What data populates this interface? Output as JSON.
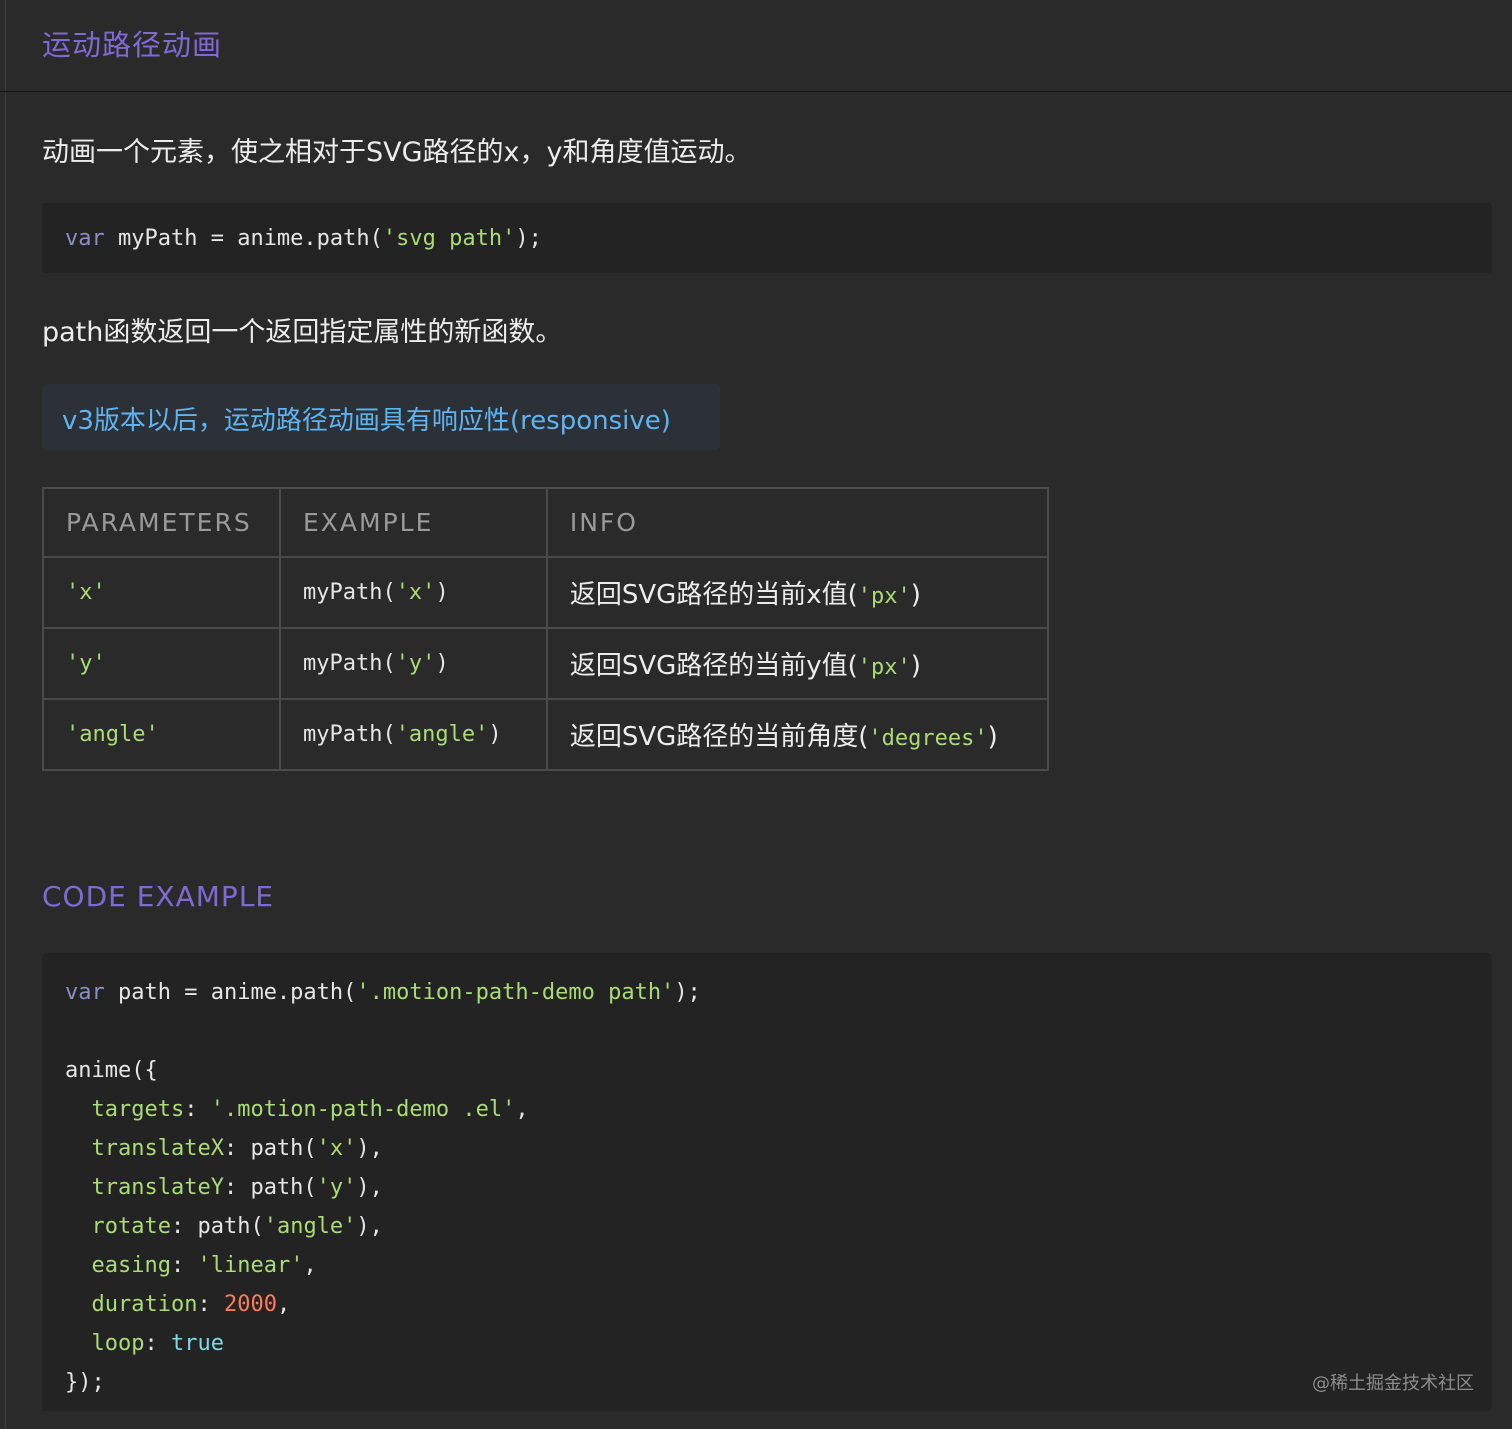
{
  "header": {
    "title": "运动路径动画"
  },
  "intro": "动画一个元素，使之相对于SVG路径的x，y和角度值运动。",
  "snippet": {
    "kw": "var",
    "mid": " myPath = anime.path(",
    "str": "'svg path'",
    "end": ");"
  },
  "path_desc": "path函数返回一个返回指定属性的新函数。",
  "note": "v3版本以后，运动路径动画具有响应性(responsive)",
  "table": {
    "headers": [
      "PARAMETERS",
      "EXAMPLE",
      "INFO"
    ],
    "rows": [
      {
        "param": "'x'",
        "example_pre": "myPath(",
        "example_str": "'x'",
        "example_post": ")",
        "info_text": "返回SVG路径的当前x值(",
        "info_code": "'px'",
        "info_post": ")"
      },
      {
        "param": "'y'",
        "example_pre": "myPath(",
        "example_str": "'y'",
        "example_post": ")",
        "info_text": "返回SVG路径的当前y值(",
        "info_code": "'px'",
        "info_post": ")"
      },
      {
        "param": "'angle'",
        "example_pre": "myPath(",
        "example_str": "'angle'",
        "example_post": ")",
        "info_text": "返回SVG路径的当前角度(",
        "info_code": "'degrees'",
        "info_post": ")"
      }
    ]
  },
  "section_title": "CODE EXAMPLE",
  "code": {
    "l1_kw": "var",
    "l1_mid": " path = anime.path(",
    "l1_str": "'.motion-path-demo path'",
    "l1_end": ");",
    "l3": "anime({",
    "targets_key": "targets",
    "targets_val": "'.motion-path-demo .el'",
    "tx_key": "translateX",
    "tx_pre": ": path(",
    "tx_str": "'x'",
    "tx_post": "),",
    "ty_key": "translateY",
    "ty_pre": ": path(",
    "ty_str": "'y'",
    "ty_post": "),",
    "rot_key": "rotate",
    "rot_pre": ": path(",
    "rot_str": "'angle'",
    "rot_post": "),",
    "ease_key": "easing",
    "ease_val": "'linear'",
    "dur_key": "duration",
    "dur_val": "2000",
    "loop_key": "loop",
    "loop_val": "true",
    "close": "});"
  },
  "watermark": "@稀土掘金技术社区",
  "colors": {
    "accent": "#7e6ad4",
    "string": "#a9dc76",
    "keyword": "#8a8fc8",
    "number": "#ff7a5c",
    "boolean": "#78dce8",
    "note": "#5fb3f0"
  }
}
